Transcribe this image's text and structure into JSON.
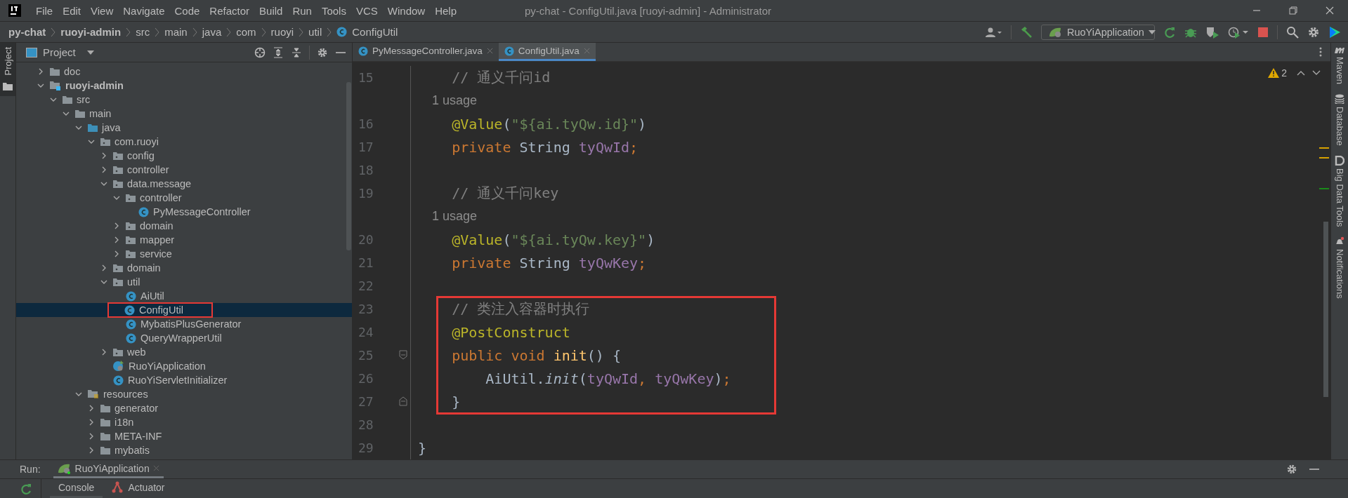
{
  "window": {
    "title": "py-chat - ConfigUtil.java [ruoyi-admin] - Administrator"
  },
  "menu": [
    "File",
    "Edit",
    "View",
    "Navigate",
    "Code",
    "Refactor",
    "Build",
    "Run",
    "Tools",
    "VCS",
    "Window",
    "Help"
  ],
  "breadcrumb": [
    {
      "label": "py-chat",
      "kind": "project"
    },
    {
      "label": "ruoyi-admin",
      "kind": "module"
    },
    {
      "label": "src",
      "kind": "dir"
    },
    {
      "label": "main",
      "kind": "dir"
    },
    {
      "label": "java",
      "kind": "dir"
    },
    {
      "label": "com",
      "kind": "dir"
    },
    {
      "label": "ruoyi",
      "kind": "dir"
    },
    {
      "label": "util",
      "kind": "dir"
    },
    {
      "label": "ConfigUtil",
      "kind": "class"
    }
  ],
  "run_config": {
    "label": "RuoYiApplication"
  },
  "left_stripe": [
    "Project"
  ],
  "project": {
    "title": "Project",
    "tree": [
      {
        "label": "doc",
        "kind": "folder",
        "expanded": false,
        "selected": false,
        "boxed": false
      },
      {
        "label": "ruoyi-admin",
        "kind": "module",
        "expanded": true,
        "selected": false,
        "boxed": false,
        "children": [
          {
            "label": "src",
            "kind": "folder",
            "expanded": true,
            "selected": false,
            "boxed": false,
            "children": [
              {
                "label": "main",
                "kind": "folder",
                "expanded": true,
                "selected": false,
                "boxed": false,
                "children": [
                  {
                    "label": "java",
                    "kind": "source",
                    "expanded": true,
                    "selected": false,
                    "boxed": false,
                    "children": [
                      {
                        "label": "com.ruoyi",
                        "kind": "package",
                        "expanded": true,
                        "selected": false,
                        "boxed": false,
                        "children": [
                          {
                            "label": "config",
                            "kind": "package",
                            "expanded": false,
                            "selected": false,
                            "boxed": false
                          },
                          {
                            "label": "controller",
                            "kind": "package",
                            "expanded": false,
                            "selected": false,
                            "boxed": false
                          },
                          {
                            "label": "data.message",
                            "kind": "package",
                            "expanded": true,
                            "selected": false,
                            "boxed": false,
                            "children": [
                              {
                                "label": "controller",
                                "kind": "package",
                                "expanded": true,
                                "selected": false,
                                "boxed": false,
                                "children": [
                                  {
                                    "label": "PyMessageController",
                                    "kind": "class",
                                    "selected": false,
                                    "boxed": false
                                  }
                                ]
                              },
                              {
                                "label": "domain",
                                "kind": "package",
                                "expanded": false,
                                "selected": false,
                                "boxed": false
                              },
                              {
                                "label": "mapper",
                                "kind": "package",
                                "expanded": false,
                                "selected": false,
                                "boxed": false
                              },
                              {
                                "label": "service",
                                "kind": "package",
                                "expanded": false,
                                "selected": false,
                                "boxed": false
                              }
                            ]
                          },
                          {
                            "label": "domain",
                            "kind": "package",
                            "expanded": false,
                            "selected": false,
                            "boxed": false
                          },
                          {
                            "label": "util",
                            "kind": "package",
                            "expanded": true,
                            "selected": false,
                            "boxed": false,
                            "children": [
                              {
                                "label": "AiUtil",
                                "kind": "class",
                                "selected": false,
                                "boxed": false
                              },
                              {
                                "label": "ConfigUtil",
                                "kind": "class",
                                "selected": true,
                                "boxed": true
                              },
                              {
                                "label": "MybatisPlusGenerator",
                                "kind": "class",
                                "selected": false,
                                "boxed": false
                              },
                              {
                                "label": "QueryWrapperUtil",
                                "kind": "class",
                                "selected": false,
                                "boxed": false
                              }
                            ]
                          },
                          {
                            "label": "web",
                            "kind": "package",
                            "expanded": false,
                            "selected": false,
                            "boxed": false
                          },
                          {
                            "label": "RuoYiApplication",
                            "kind": "boot",
                            "selected": false,
                            "boxed": false
                          },
                          {
                            "label": "RuoYiServletInitializer",
                            "kind": "class",
                            "selected": false,
                            "boxed": false
                          }
                        ]
                      }
                    ]
                  },
                  {
                    "label": "resources",
                    "kind": "resources",
                    "expanded": true,
                    "selected": false,
                    "boxed": false,
                    "children": [
                      {
                        "label": "generator",
                        "kind": "folder",
                        "expanded": false,
                        "selected": false,
                        "boxed": false
                      },
                      {
                        "label": "i18n",
                        "kind": "folder",
                        "expanded": false,
                        "selected": false,
                        "boxed": false
                      },
                      {
                        "label": "META-INF",
                        "kind": "folder",
                        "expanded": false,
                        "selected": false,
                        "boxed": false
                      },
                      {
                        "label": "mybatis",
                        "kind": "folder",
                        "expanded": false,
                        "selected": false,
                        "boxed": false
                      }
                    ]
                  }
                ]
              }
            ]
          }
        ]
      }
    ]
  },
  "editor": {
    "tabs": [
      {
        "label": "PyMessageController.java",
        "selected": false
      },
      {
        "label": "ConfigUtil.java",
        "selected": true
      }
    ],
    "warnings": "2",
    "blocks": [
      {
        "boxed": false,
        "lines": [
          {
            "kind": "code",
            "number": "15",
            "tokens": [
              {
                "kind": "comment",
                "text": "    // 通义千问id"
              }
            ]
          },
          {
            "kind": "hint",
            "tokens": [
              {
                "kind": "hint",
                "text": "    1 usage"
              }
            ]
          },
          {
            "kind": "code",
            "number": "16",
            "tokens": [
              {
                "kind": "annotation",
                "text": "    @Value"
              },
              {
                "kind": "plain",
                "text": "("
              },
              {
                "kind": "string",
                "text": "\"${ai.tyQw.id}\""
              },
              {
                "kind": "plain",
                "text": ")"
              }
            ]
          },
          {
            "kind": "code",
            "number": "17",
            "tokens": [
              {
                "kind": "keyword",
                "text": "    private "
              },
              {
                "kind": "plain",
                "text": "String "
              },
              {
                "kind": "field",
                "text": "tyQwId"
              },
              {
                "kind": "keyword",
                "text": ";"
              }
            ]
          },
          {
            "kind": "code",
            "number": "18"
          },
          {
            "kind": "code",
            "number": "19",
            "tokens": [
              {
                "kind": "comment",
                "text": "    // 通义千问key"
              }
            ]
          },
          {
            "kind": "hint",
            "tokens": [
              {
                "kind": "hint",
                "text": "    1 usage"
              }
            ]
          },
          {
            "kind": "code",
            "number": "20",
            "tokens": [
              {
                "kind": "annotation",
                "text": "    @Value"
              },
              {
                "kind": "plain",
                "text": "("
              },
              {
                "kind": "string",
                "text": "\"${ai.tyQw.key}\""
              },
              {
                "kind": "plain",
                "text": ")"
              }
            ]
          },
          {
            "kind": "code",
            "number": "21",
            "tokens": [
              {
                "kind": "keyword",
                "text": "    private "
              },
              {
                "kind": "plain",
                "text": "String "
              },
              {
                "kind": "field",
                "text": "tyQwKey"
              },
              {
                "kind": "keyword",
                "text": ";"
              }
            ]
          },
          {
            "kind": "code",
            "number": "22"
          }
        ]
      },
      {
        "boxed": true,
        "lines": [
          {
            "kind": "code",
            "number": "23",
            "tokens": [
              {
                "kind": "comment",
                "text": "    // 类注入容器时执行"
              }
            ]
          },
          {
            "kind": "code",
            "number": "24",
            "tokens": [
              {
                "kind": "annotation",
                "text": "    @PostConstruct"
              }
            ]
          },
          {
            "kind": "fold_start",
            "number": "25",
            "tokens": [
              {
                "kind": "keyword",
                "text": "    public void "
              },
              {
                "kind": "method",
                "text": "init"
              },
              {
                "kind": "plain",
                "text": "() {"
              }
            ]
          },
          {
            "kind": "code",
            "number": "26",
            "tokens": [
              {
                "kind": "plain",
                "text": "        AiUtil."
              },
              {
                "kind": "static",
                "text": "init"
              },
              {
                "kind": "plain",
                "text": "("
              },
              {
                "kind": "field",
                "text": "tyQwId"
              },
              {
                "kind": "keyword",
                "text": ", "
              },
              {
                "kind": "field",
                "text": "tyQwKey"
              },
              {
                "kind": "plain",
                "text": ")"
              },
              {
                "kind": "keyword",
                "text": ";"
              }
            ]
          },
          {
            "kind": "fold_end",
            "number": "27",
            "tokens": [
              {
                "kind": "plain",
                "text": "    }"
              }
            ]
          }
        ]
      },
      {
        "boxed": false,
        "lines": [
          {
            "kind": "code",
            "number": "28"
          },
          {
            "kind": "code",
            "number": "29",
            "tokens": [
              {
                "kind": "plain",
                "text": "}"
              }
            ]
          }
        ]
      }
    ]
  },
  "right_stripe": [
    {
      "label": "Maven",
      "kind": "maven"
    },
    {
      "label": "Database",
      "kind": "database"
    },
    {
      "label": "Big Data Tools",
      "kind": "bigdata"
    },
    {
      "label": "Notifications",
      "kind": "bell"
    }
  ],
  "run_panel": {
    "title": "Run:",
    "tabs": [
      {
        "label": "RuoYiApplication",
        "selected": true
      }
    ],
    "subtabs": [
      {
        "label": "Console",
        "selected": true
      },
      {
        "label": "Actuator",
        "selected": false
      }
    ]
  }
}
